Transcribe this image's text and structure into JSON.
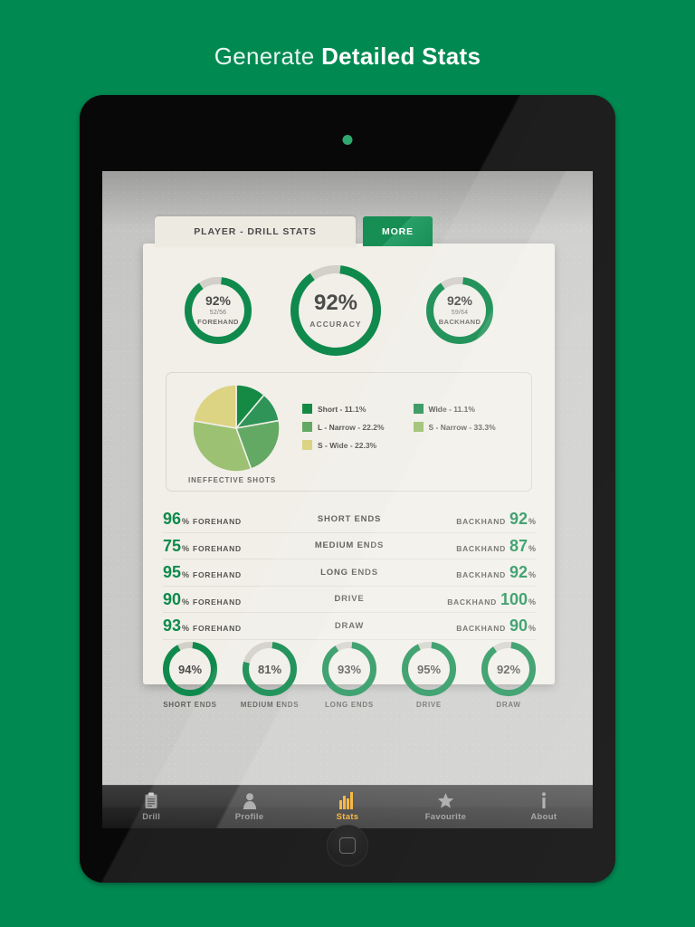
{
  "headline": {
    "light": "Generate ",
    "bold": "Detailed Stats"
  },
  "device": {
    "camera": "camera-dot",
    "home": "home-button"
  },
  "tabs": {
    "main": "PLAYER - DRILL STATS",
    "more": "MORE"
  },
  "top_gauges": [
    {
      "pct": "92%",
      "value": 92,
      "fraction": "52/56",
      "label": "FOREHAND"
    },
    {
      "pct": "92%",
      "value": 92,
      "fraction": "",
      "label": "ACCURACY"
    },
    {
      "pct": "92%",
      "value": 92,
      "fraction": "59/64",
      "label": "BACKHAND"
    }
  ],
  "pie": {
    "caption": "INEFFECTIVE SHOTS",
    "legend": [
      {
        "label": "Short - 11.1%",
        "color": "#148a44"
      },
      {
        "label": "Wide - 11.1%",
        "color": "#2e9458"
      },
      {
        "label": "L - Narrow - 22.2%",
        "color": "#63a963"
      },
      {
        "label": "S - Narrow - 33.3%",
        "color": "#9cc172"
      },
      {
        "label": "S - Wide - 22.3%",
        "color": "#dcd383"
      }
    ]
  },
  "chart_data": {
    "type": "pie",
    "title": "INEFFECTIVE SHOTS",
    "categories": [
      "Short",
      "Wide",
      "L - Narrow",
      "S - Narrow",
      "S - Wide"
    ],
    "values": [
      11.1,
      11.1,
      22.2,
      33.3,
      22.3
    ],
    "colors": [
      "#148a44",
      "#2e9458",
      "#63a963",
      "#9cc172",
      "#dcd383"
    ],
    "legend_position": "right",
    "unit": "%"
  },
  "stat_rows": [
    {
      "fore": "96",
      "mid": "SHORT ENDS",
      "back": "92"
    },
    {
      "fore": "75",
      "mid": "MEDIUM ENDS",
      "back": "87"
    },
    {
      "fore": "95",
      "mid": "LONG ENDS",
      "back": "92"
    },
    {
      "fore": "90",
      "mid": "DRIVE",
      "back": "100"
    },
    {
      "fore": "93",
      "mid": "DRAW",
      "back": "90"
    }
  ],
  "stat_row_words": {
    "forehand": "FOREHAND",
    "backhand": "BACKHAND",
    "percent": "%"
  },
  "bottom_gauges": [
    {
      "pct": "94%",
      "value": 94,
      "label": "SHORT ENDS"
    },
    {
      "pct": "81%",
      "value": 81,
      "label": "MEDIUM ENDS"
    },
    {
      "pct": "93%",
      "value": 93,
      "label": "LONG ENDS"
    },
    {
      "pct": "95%",
      "value": 95,
      "label": "DRIVE"
    },
    {
      "pct": "92%",
      "value": 92,
      "label": "DRAW"
    }
  ],
  "tabbar": [
    {
      "label": "Drill",
      "icon": "clipboard-icon",
      "active": false
    },
    {
      "label": "Profile",
      "icon": "person-icon",
      "active": false
    },
    {
      "label": "Stats",
      "icon": "bar-chart-icon",
      "active": true
    },
    {
      "label": "Favourite",
      "icon": "star-icon",
      "active": false
    },
    {
      "label": "About",
      "icon": "info-icon",
      "active": false
    }
  ],
  "colors": {
    "background_green": "#008a52",
    "accent_green": "#0f8a4c",
    "track_gray": "#d2d0c8",
    "active_tab_orange": "#f5a513"
  }
}
